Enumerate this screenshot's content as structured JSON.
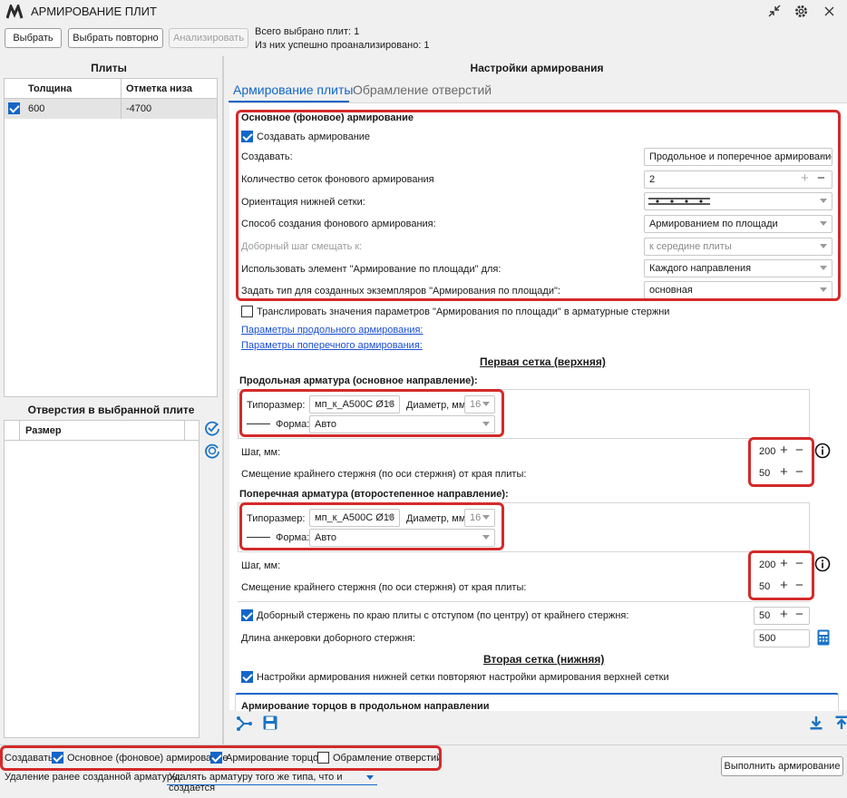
{
  "app": {
    "title": "АРМИРОВАНИЕ ПЛИТ"
  },
  "toolbar": {
    "select": "Выбрать",
    "reselect": "Выбрать повторно",
    "analyze": "Анализировать",
    "status_total": "Всего выбрано плит: 1",
    "status_analyzed": "Из них успешно проанализировано: 1"
  },
  "slabs": {
    "title": "Плиты",
    "columns": [
      "Толщина",
      "Отметка низа"
    ],
    "rows": [
      {
        "thickness": "600",
        "elevation": "-4700",
        "checked": true
      }
    ]
  },
  "openings": {
    "title": "Отверстия в выбранной плите",
    "columns": [
      "Размер"
    ]
  },
  "settings": {
    "title": "Настройки армирования",
    "tabs": [
      "Армирование плиты",
      "Обрамление отверстий"
    ],
    "base": {
      "title": "Основное (фоновое) армирование",
      "create_label": "Создавать армирование",
      "create_checked": true,
      "rows": [
        {
          "label": "Создавать:",
          "value": "Продольное и поперечное армирование"
        },
        {
          "label": "Количество сеток фонового армирования",
          "value": "2"
        },
        {
          "label": "Ориентация нижней сетки:",
          "value": ""
        },
        {
          "label": "Способ создания фонового армирования:",
          "value": "Армированием по площади"
        },
        {
          "label": "Доборный шаг смещать к:",
          "value": "к середине плиты"
        },
        {
          "label": "Использовать элемент \"Армирование по площади\" для:",
          "value": "Каждого направления"
        },
        {
          "label": "Задать тип для созданных экземпляров \"Армирования по площади\":",
          "value": "основная"
        }
      ]
    },
    "translate_label": "Транслировать значения параметров \"Армирования по площади\" в арматурные стержни",
    "link_long": "Параметры продольного армирования:",
    "link_trans": "Параметры поперечного армирования:",
    "first_mesh": {
      "title": "Первая сетка (верхняя)",
      "longitudinal": {
        "title": "Продольная арматура (основное направление):",
        "type_label": "Типоразмер:",
        "type_value": "мп_к_А500С Ø16",
        "diam_label": "Диаметр, мм:",
        "diam_value": "16",
        "form_label": "Форма:",
        "form_value": "Авто",
        "step_label": "Шаг, мм:",
        "step_value": "200",
        "offset_label": "Смещение крайнего стержня (по оси стержня) от края плиты:",
        "offset_value": "50"
      },
      "transverse": {
        "title": "Поперечная арматура (второстепенное направление):",
        "type_label": "Типоразмер:",
        "type_value": "мп_к_А500С Ø16",
        "diam_label": "Диаметр, мм:",
        "diam_value": "16",
        "form_label": "Форма:",
        "form_value": "Авто",
        "step_label": "Шаг, мм:",
        "step_value": "200",
        "offset_label": "Смещение крайнего стержня (по оси стержня) от края плиты:",
        "offset_value": "50"
      },
      "extra_bar_label": "Доборный стержень по краю плиты с отступом (по центру) от крайнего стержня:",
      "extra_bar_value": "50",
      "anchor_label": "Длина анкеровки доборного стержня:",
      "anchor_value": "500"
    },
    "second_mesh": {
      "title": "Вторая сетка (нижняя)",
      "repeat_label": "Настройки армирования нижней сетки повторяют настройки армирования верхней сетки"
    },
    "ends_title": "Армирование торцов в продольном направлении"
  },
  "footer": {
    "create_label": "Создавать:",
    "options": [
      {
        "label": "Основное (фоновое) армирование",
        "checked": true
      },
      {
        "label": "Армирование торцов",
        "checked": true
      },
      {
        "label": "Обрамление отверстий",
        "checked": false
      }
    ],
    "delete_label": "Удаление ранее созданной арматуры:",
    "delete_value": "Удалять арматуру того же типа, что и создается",
    "run": "Выполнить армирование"
  },
  "colors": {
    "accent": "#1366c8",
    "highlight": "#d42a2a"
  }
}
